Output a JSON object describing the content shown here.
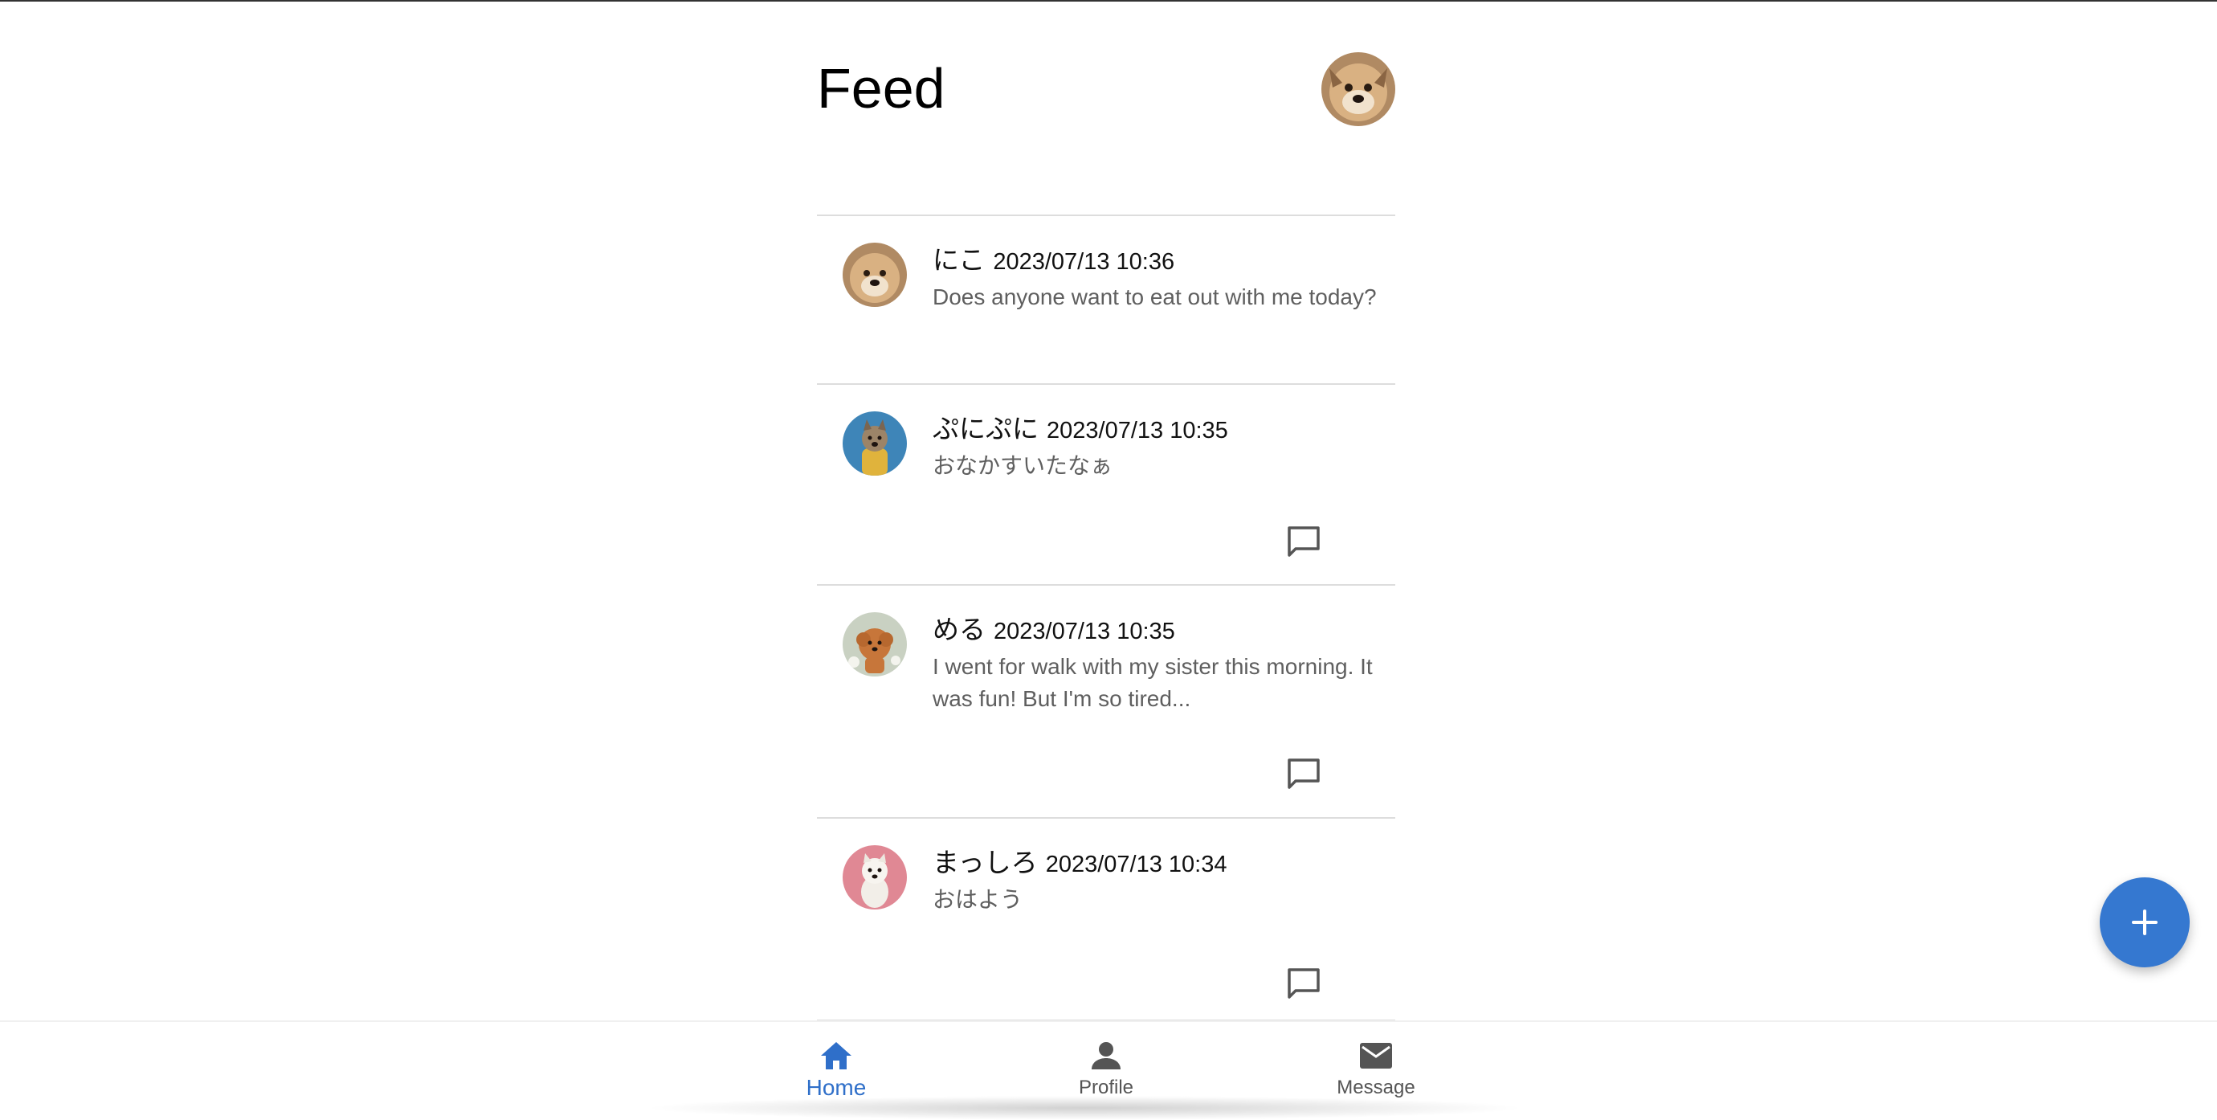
{
  "page": {
    "title": "Feed"
  },
  "colors": {
    "accent": "#3578d0",
    "active_nav": "#2f6fc9",
    "inactive_nav": "#555555",
    "divider": "#dddddd",
    "body_text": "#5f5f5f"
  },
  "header": {
    "avatar_icon": "user-avatar-dog-photo"
  },
  "posts": [
    {
      "name": "にこ",
      "time": "2023/07/13 10:36",
      "text": "Does anyone want to eat out with me today?",
      "avatar": "shiba-dog-photo",
      "has_comment_button": false
    },
    {
      "name": "ぷにぷに",
      "time": "2023/07/13 10:35",
      "text": "おなかすいたなぁ",
      "avatar": "dog-blue-bg-photo",
      "has_comment_button": true
    },
    {
      "name": "める",
      "time": "2023/07/13 10:35",
      "text": "I went for walk with my sister this morning. It was fun! But I'm so tired...",
      "avatar": "poodle-photo",
      "has_comment_button": true
    },
    {
      "name": "まっしろ",
      "time": "2023/07/13 10:34",
      "text": "おはよう",
      "avatar": "white-dog-pink-bg-photo",
      "has_comment_button": true
    }
  ],
  "fab": {
    "icon": "plus-icon"
  },
  "bottom_nav": [
    {
      "label": "Home",
      "icon": "home-icon",
      "active": true
    },
    {
      "label": "Profile",
      "icon": "person-icon",
      "active": false
    },
    {
      "label": "Message",
      "icon": "mail-icon",
      "active": false
    }
  ]
}
